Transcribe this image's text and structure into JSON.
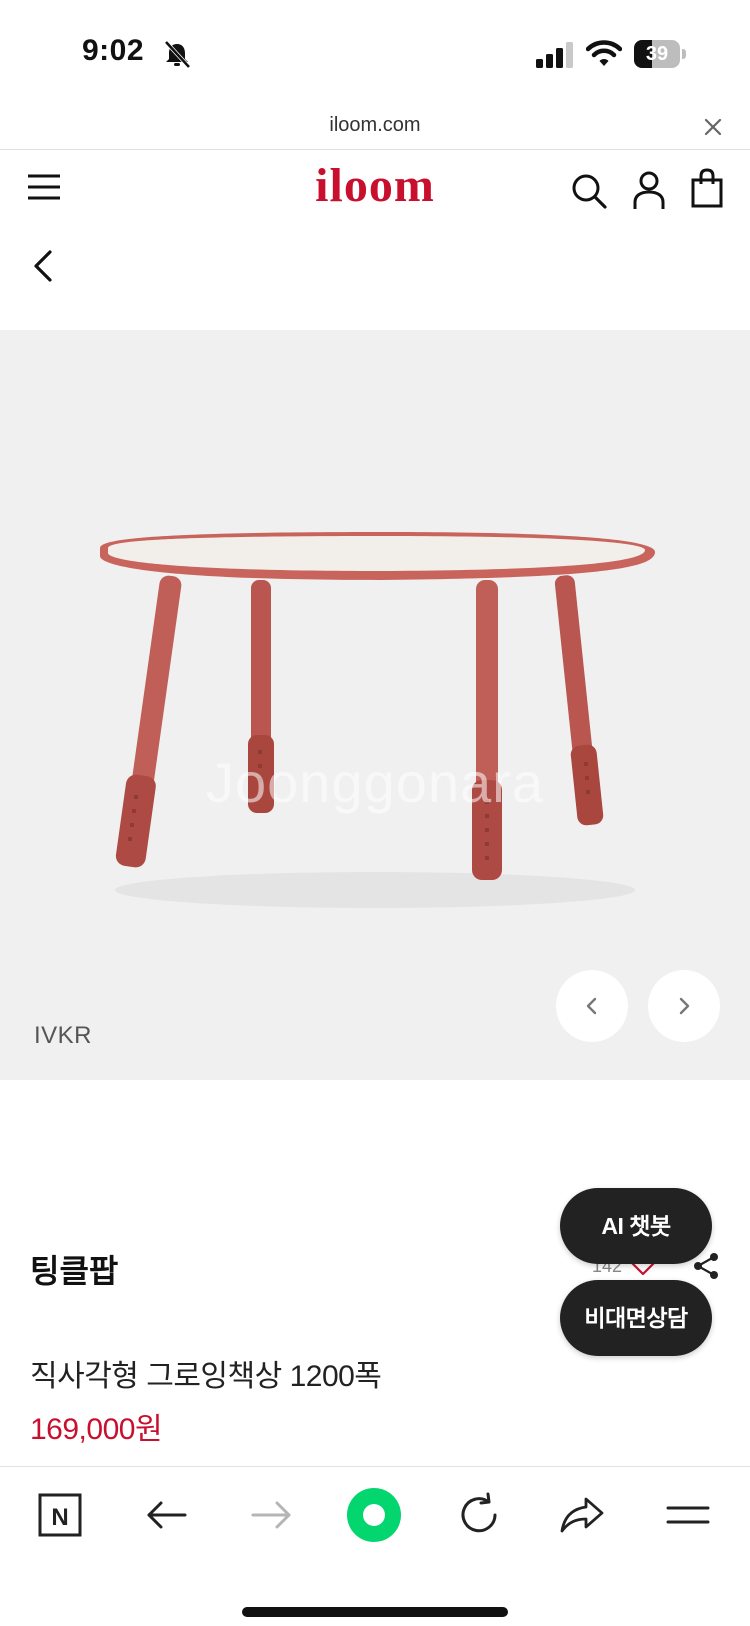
{
  "status_bar": {
    "time": "9:02",
    "battery_level": "39",
    "battery_fraction": 0.39
  },
  "browser": {
    "url": "iloom.com"
  },
  "header": {
    "logo_text": "iloom",
    "brand_color": "#c8102e"
  },
  "gallery": {
    "color_code": "IVKR",
    "watermark": "Joonggonara",
    "table_color": "#b8564f",
    "table_top_color": "#f2efeb"
  },
  "product": {
    "brand": "팅클팝",
    "title": "직사각형 그로잉책상 1200폭",
    "price": "169,000원",
    "likes": "142"
  },
  "floating_buttons": {
    "chatbot_label": "AI 챗봇",
    "consult_label": "비대면상담"
  },
  "toolbar": {
    "naver_label": "N",
    "green_accent": "#03d66f"
  }
}
